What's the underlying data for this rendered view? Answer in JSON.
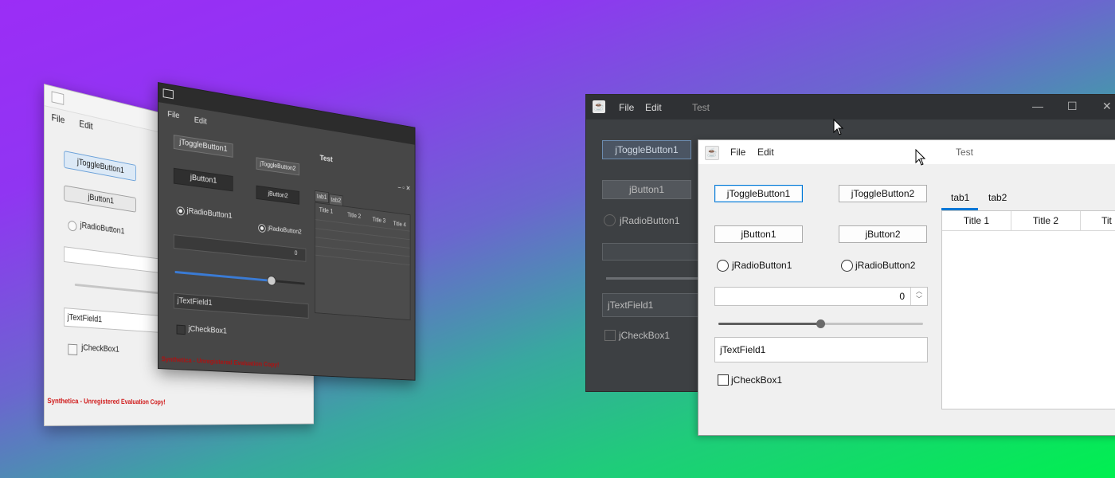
{
  "colors": {
    "accent_blue": "#0078d7",
    "watermark_red": "#d01818"
  },
  "tilted_light_window": {
    "menu": [
      "File",
      "Edit"
    ],
    "toggle_button_1": "jToggleButton1",
    "button_1": "jButton1",
    "radio_1": "jRadioButton1",
    "text_field": "jTextField1",
    "checkbox_1": "jCheckBox1",
    "watermark": "Synthetica - Unregistered Evaluation Copy!"
  },
  "tilted_dark_window": {
    "title": "Test",
    "menu": [
      "File",
      "Edit"
    ],
    "toggle_button_1": "jToggleButton1",
    "toggle_button_2": "jToggleButton2",
    "button_1": "jButton1",
    "button_2": "jButton2",
    "radio_1": "jRadioButton1",
    "radio_2": "jRadioButton2",
    "spinner_value": "0",
    "slider_value_fraction": 0.73,
    "text_field": "jTextField1",
    "checkbox_1": "jCheckBox1",
    "tabs": [
      "tab1",
      "tab2"
    ],
    "table_headers": [
      "Title 1",
      "Title 2",
      "Title 3",
      "Title 4"
    ],
    "watermark": "Synthetica - Unregistered Evaluation Copy!"
  },
  "right_dark_window": {
    "title": "Test",
    "menu": [
      "File",
      "Edit"
    ],
    "toggle_button_1": "jToggleButton1",
    "button_1": "jButton1",
    "radio_1": "jRadioButton1",
    "text_field": "jTextField1",
    "checkbox_1": "jCheckBox1"
  },
  "right_light_window": {
    "title": "Test",
    "menu": [
      "File",
      "Edit"
    ],
    "toggle_button_1": "jToggleButton1",
    "toggle_button_2": "jToggleButton2",
    "button_1": "jButton1",
    "button_2": "jButton2",
    "radio_1": "jRadioButton1",
    "radio_2": "jRadioButton2",
    "spinner_value": "0",
    "slider_value_fraction": 0.5,
    "text_field": "jTextField1",
    "checkbox_1": "jCheckBox1",
    "tabs": [
      "tab1",
      "tab2"
    ],
    "table_headers": [
      "Title 1",
      "Title 2",
      "Tit"
    ]
  },
  "icons": {
    "java": "java-app-icon",
    "minimize": "minimize-icon",
    "maximize": "maximize-icon",
    "close": "close-icon",
    "cursor": "mouse-pointer-icon"
  }
}
